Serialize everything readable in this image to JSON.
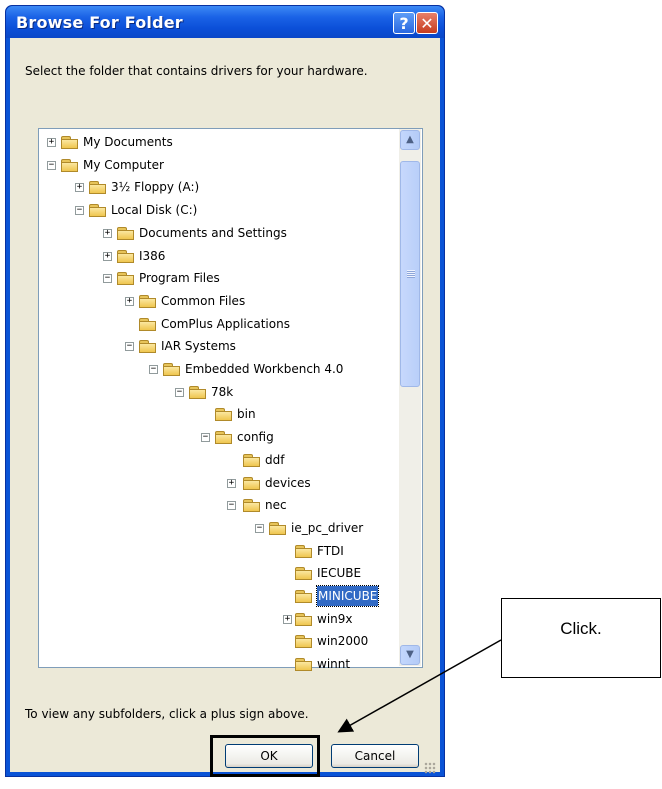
{
  "dialog": {
    "title": "Browse For Folder",
    "help_button": "?",
    "close_button": "✕",
    "instruction": "Select the folder that contains drivers for your hardware.",
    "hint": "To view any subfolders, click a plus sign above.",
    "ok_label": "OK",
    "cancel_label": "Cancel"
  },
  "tree": {
    "items": [
      {
        "label": "My Documents",
        "expander": "+",
        "icon": "my-documents-icon"
      },
      {
        "label": "My Computer",
        "expander": "−",
        "icon": "my-computer-icon"
      },
      {
        "label": "3½ Floppy (A:)",
        "expander": "+",
        "icon": "floppy-drive-icon"
      },
      {
        "label": "Local Disk (C:)",
        "expander": "−",
        "icon": "hard-disk-icon"
      },
      {
        "label": "Documents and Settings",
        "expander": "+",
        "icon": "folder-icon"
      },
      {
        "label": "I386",
        "expander": "+",
        "icon": "folder-icon"
      },
      {
        "label": "Program Files",
        "expander": "−",
        "icon": "folder-icon"
      },
      {
        "label": "Common Files",
        "expander": "+",
        "icon": "folder-icon"
      },
      {
        "label": "ComPlus Applications",
        "expander": "",
        "icon": "folder-icon"
      },
      {
        "label": "IAR Systems",
        "expander": "−",
        "icon": "folder-icon"
      },
      {
        "label": "Embedded Workbench 4.0",
        "expander": "−",
        "icon": "folder-icon"
      },
      {
        "label": "78k",
        "expander": "−",
        "icon": "folder-icon"
      },
      {
        "label": "bin",
        "expander": "",
        "icon": "folder-icon"
      },
      {
        "label": "config",
        "expander": "−",
        "icon": "folder-icon"
      },
      {
        "label": "ddf",
        "expander": "",
        "icon": "folder-icon"
      },
      {
        "label": "devices",
        "expander": "+",
        "icon": "folder-icon"
      },
      {
        "label": "nec",
        "expander": "−",
        "icon": "folder-icon"
      },
      {
        "label": "ie_pc_driver",
        "expander": "−",
        "icon": "folder-icon"
      },
      {
        "label": "FTDI",
        "expander": "",
        "icon": "folder-icon"
      },
      {
        "label": "IECUBE",
        "expander": "",
        "icon": "folder-icon"
      },
      {
        "label": "MINICUBE",
        "expander": "",
        "icon": "folder-icon",
        "selected": true
      },
      {
        "label": "win9x",
        "expander": "+",
        "icon": "folder-icon"
      },
      {
        "label": "win2000",
        "expander": "",
        "icon": "folder-icon"
      },
      {
        "label": "winnt",
        "expander": "",
        "icon": "folder-icon"
      }
    ]
  },
  "callout": {
    "text": "Click."
  },
  "colors": {
    "titlebar": "#0a53d6",
    "selection": "#316ac5",
    "dialog_face": "#ece9d8"
  }
}
